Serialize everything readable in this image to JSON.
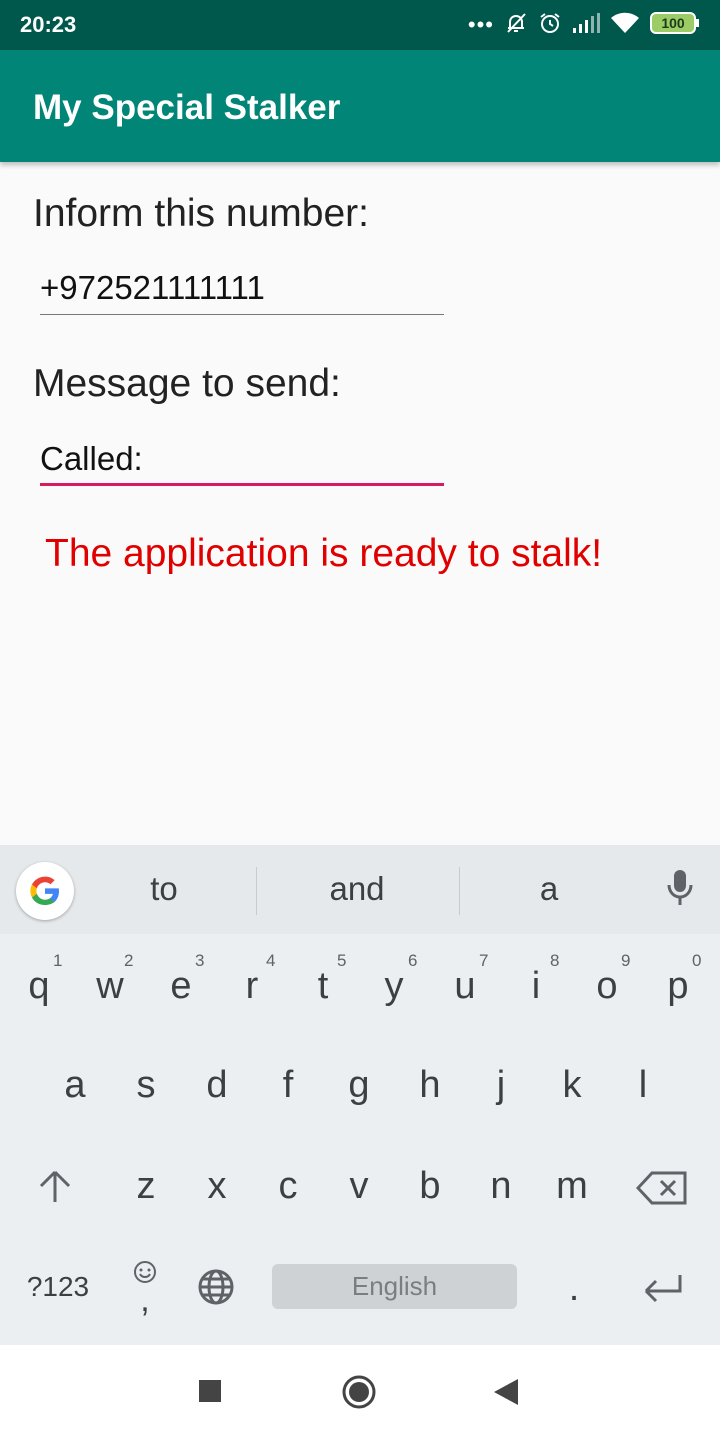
{
  "status_bar": {
    "time": "20:23",
    "battery": "100"
  },
  "app_bar": {
    "title": "My Special Stalker"
  },
  "form": {
    "number_label": "Inform this number:",
    "number_value": "+972521111111",
    "message_label": "Message to send:",
    "message_value": "Called:",
    "status_text": "The application is ready to stalk!"
  },
  "keyboard": {
    "suggestions": [
      "to",
      "and",
      "a"
    ],
    "row1": [
      {
        "key": "q",
        "hint": "1"
      },
      {
        "key": "w",
        "hint": "2"
      },
      {
        "key": "e",
        "hint": "3"
      },
      {
        "key": "r",
        "hint": "4"
      },
      {
        "key": "t",
        "hint": "5"
      },
      {
        "key": "y",
        "hint": "6"
      },
      {
        "key": "u",
        "hint": "7"
      },
      {
        "key": "i",
        "hint": "8"
      },
      {
        "key": "o",
        "hint": "9"
      },
      {
        "key": "p",
        "hint": "0"
      }
    ],
    "row2": [
      "a",
      "s",
      "d",
      "f",
      "g",
      "h",
      "j",
      "k",
      "l"
    ],
    "row3": [
      "z",
      "x",
      "c",
      "v",
      "b",
      "n",
      "m"
    ],
    "symbols_label": "?123",
    "comma": ",",
    "space_label": "English",
    "period": "."
  },
  "colors": {
    "status_bar": "#00574b",
    "app_bar": "#008577",
    "accent": "#d81b60",
    "status_text": "#e00000"
  }
}
